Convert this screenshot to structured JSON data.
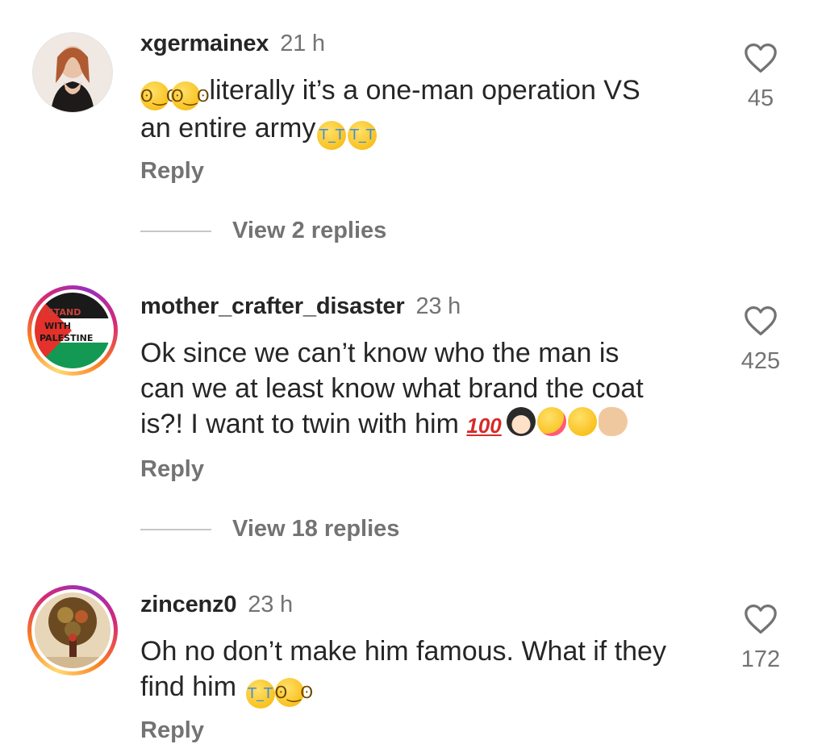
{
  "comments": [
    {
      "username": "xgermainex",
      "time": "21 h",
      "text": "literally it’s a one-man operation VS an entire army",
      "text_line1": "literally it’s a one-man operation VS",
      "text_line2": "an entire army",
      "emoji_leading": [
        "pleading-face",
        "pleading-face"
      ],
      "emoji_trailing": [
        "loudly-crying-face",
        "loudly-crying-face"
      ],
      "reply_label": "Reply",
      "view_replies": "View 2 replies",
      "likes": "45",
      "avatar": "profile-photo"
    },
    {
      "username": "mother_crafter_disaster",
      "time": "23 h",
      "text_line1": "Ok since we can’t know who the man is",
      "text_line2": "can we at least know what brand the coat",
      "text_line3": "is?! I want to twin with him",
      "emoji_trailing": [
        "hundred-points",
        "person-shrugging",
        "smiling-face-with-hearts",
        "disappointed-face",
        "pinching-hand"
      ],
      "reply_label": "Reply",
      "view_replies": "View 18 replies",
      "likes": "425",
      "avatar": "i-stand-with-palestine-badge",
      "avatar_text": {
        "line1": "I STAND",
        "line2": "WITH",
        "line3": "PALESTINE"
      }
    },
    {
      "username": "zincenz0",
      "time": "23 h",
      "text_line1": "Oh no don’t make him famous. What if they",
      "text_line2": "find him",
      "emoji_trailing": [
        "loudly-crying-face",
        "pleading-face"
      ],
      "reply_label": "Reply",
      "likes": "172",
      "avatar": "artwork-figure-tree"
    }
  ],
  "colors": {
    "text": "#262626",
    "secondary": "#737373",
    "divider": "#c7c7c7",
    "story_ring": [
      "#feda75",
      "#fa7e1e",
      "#d62976",
      "#962fbf"
    ]
  },
  "icons": {
    "like": "heart-outline-icon"
  }
}
